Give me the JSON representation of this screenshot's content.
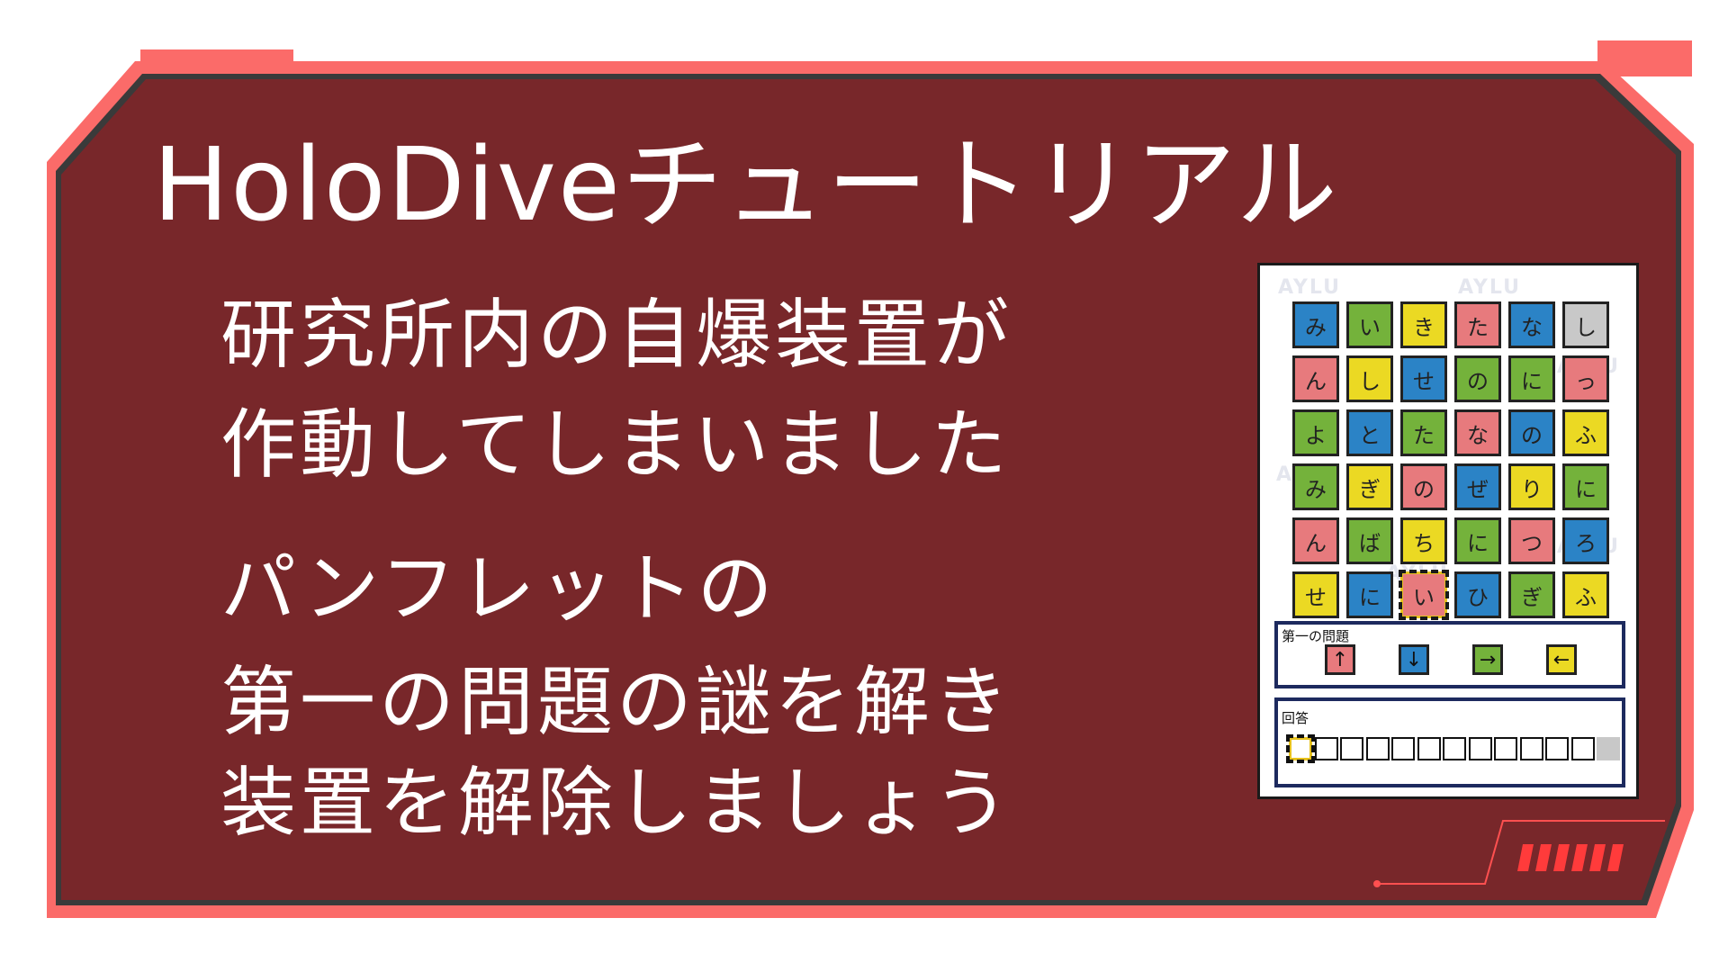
{
  "title": "HoloDiveチュートリアル",
  "messages": [
    "研究所内の自爆装置が",
    "作動してしまいました",
    "パンフレットの",
    "第一の問題の謎を解き",
    "装置を解除しましょう"
  ],
  "colors": {
    "frame_outer": "#fb6b69",
    "frame_inner": "#78272a",
    "frame_border": "#3a3a3a",
    "blue": "#2b83c6",
    "green": "#74b23b",
    "yellow": "#ebd923",
    "pink": "#e77a7d",
    "gray": "#c8c8c8"
  },
  "puzzle": {
    "watermark": "AYLU",
    "grid": [
      [
        {
          "t": "み",
          "c": "blue"
        },
        {
          "t": "い",
          "c": "green"
        },
        {
          "t": "き",
          "c": "yellow"
        },
        {
          "t": "た",
          "c": "pink"
        },
        {
          "t": "な",
          "c": "blue"
        },
        {
          "t": "し",
          "c": "gray"
        }
      ],
      [
        {
          "t": "ん",
          "c": "pink"
        },
        {
          "t": "し",
          "c": "yellow"
        },
        {
          "t": "せ",
          "c": "blue"
        },
        {
          "t": "の",
          "c": "green"
        },
        {
          "t": "に",
          "c": "green"
        },
        {
          "t": "っ",
          "c": "pink"
        }
      ],
      [
        {
          "t": "よ",
          "c": "green"
        },
        {
          "t": "と",
          "c": "blue"
        },
        {
          "t": "た",
          "c": "green"
        },
        {
          "t": "な",
          "c": "pink"
        },
        {
          "t": "の",
          "c": "blue"
        },
        {
          "t": "ふ",
          "c": "yellow"
        }
      ],
      [
        {
          "t": "み",
          "c": "green"
        },
        {
          "t": "ぎ",
          "c": "yellow"
        },
        {
          "t": "の",
          "c": "pink"
        },
        {
          "t": "ぜ",
          "c": "blue"
        },
        {
          "t": "り",
          "c": "yellow"
        },
        {
          "t": "に",
          "c": "green"
        }
      ],
      [
        {
          "t": "ん",
          "c": "pink"
        },
        {
          "t": "ば",
          "c": "green"
        },
        {
          "t": "ち",
          "c": "yellow"
        },
        {
          "t": "に",
          "c": "green"
        },
        {
          "t": "つ",
          "c": "pink"
        },
        {
          "t": "ろ",
          "c": "blue"
        }
      ],
      [
        {
          "t": "せ",
          "c": "yellow"
        },
        {
          "t": "に",
          "c": "blue"
        },
        {
          "t": "い",
          "c": "pink",
          "selected": true
        },
        {
          "t": "ひ",
          "c": "blue"
        },
        {
          "t": "ぎ",
          "c": "green"
        },
        {
          "t": "ふ",
          "c": "yellow"
        }
      ]
    ],
    "question_label": "第一の問題",
    "arrows": [
      {
        "t": "↑",
        "c": "pink"
      },
      {
        "t": "↓",
        "c": "blue"
      },
      {
        "t": "→",
        "c": "green"
      },
      {
        "t": "←",
        "c": "yellow"
      }
    ],
    "answer_label": "回答",
    "answer_slots": 13,
    "answer_active_index": 0
  }
}
